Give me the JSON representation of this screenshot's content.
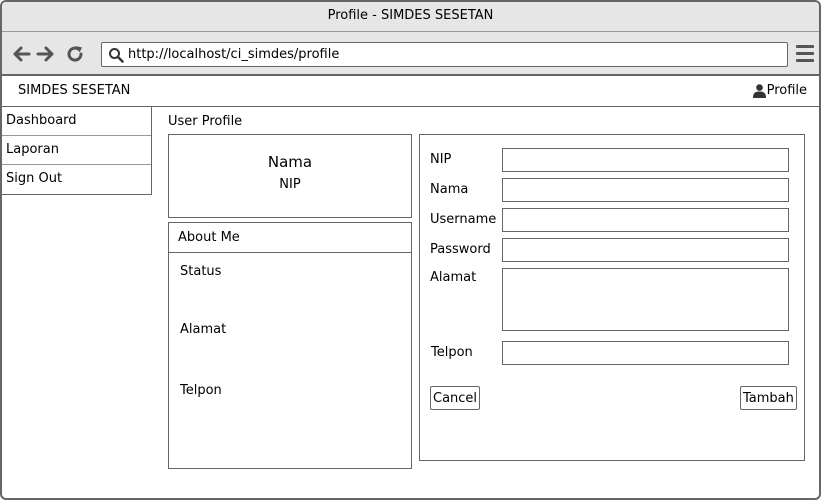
{
  "window": {
    "title": "Profile - SIMDES SESETAN"
  },
  "browser": {
    "url": "http://localhost/ci_simdes/profile"
  },
  "app": {
    "title": "SIMDES SESETAN",
    "profile_label": "Profile"
  },
  "sidebar": {
    "items": [
      {
        "label": "Dashboard"
      },
      {
        "label": "Laporan"
      },
      {
        "label": "Sign Out"
      }
    ]
  },
  "main": {
    "section_title": "User Profile",
    "name_card": {
      "name": "Nama",
      "nip": "NIP"
    },
    "about": {
      "heading": "About Me",
      "status": "Status",
      "alamat": "Alamat",
      "telpon": "Telpon"
    }
  },
  "form": {
    "fields": [
      {
        "label": "NIP",
        "value": ""
      },
      {
        "label": "Nama",
        "value": ""
      },
      {
        "label": "Username",
        "value": ""
      },
      {
        "label": "Password",
        "value": ""
      },
      {
        "label": "Alamat",
        "value": ""
      },
      {
        "label": "Telpon",
        "value": ""
      }
    ],
    "cancel_label": "Cancel",
    "submit_label": "Tambah"
  },
  "icons": {
    "back": "arrow-left-icon",
    "forward": "arrow-right-icon",
    "reload": "reload-icon",
    "search": "search-icon",
    "menu": "hamburger-menu-icon",
    "user": "user-icon"
  }
}
